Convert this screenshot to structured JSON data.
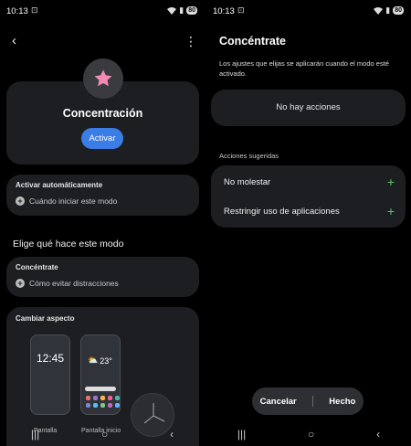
{
  "status": {
    "time": "10:13",
    "battery": "80"
  },
  "left": {
    "title": "Concentración",
    "activate_label": "Activar",
    "auto": {
      "title": "Activar automáticamente",
      "add_label": "Cuándo iniciar este modo"
    },
    "section_heading": "Elige qué hace este modo",
    "focus": {
      "title": "Concéntrate",
      "add_label": "Cómo evitar distracciones"
    },
    "look": {
      "title": "Cambiar aspecto",
      "lock_time": "12:45",
      "weather_temp": "23°",
      "tile1_label": "Pantalla",
      "tile2_label": "Pantalla inicio"
    }
  },
  "right": {
    "title": "Concéntrate",
    "description": "Los ajustes que elijas se aplicarán cuando el modo esté activado.",
    "no_actions": "No hay acciones",
    "suggested_heading": "Acciones sugeridas",
    "suggestions": [
      {
        "label": "No molestar"
      },
      {
        "label": "Restringir uso de aplicaciones"
      }
    ],
    "cancel_label": "Cancelar",
    "done_label": "Hecho"
  },
  "colors": {
    "accent": "#3a7de6",
    "plus_green": "#5ec46a",
    "star_pink": "#f28bb0",
    "card": "#1d1e21"
  }
}
